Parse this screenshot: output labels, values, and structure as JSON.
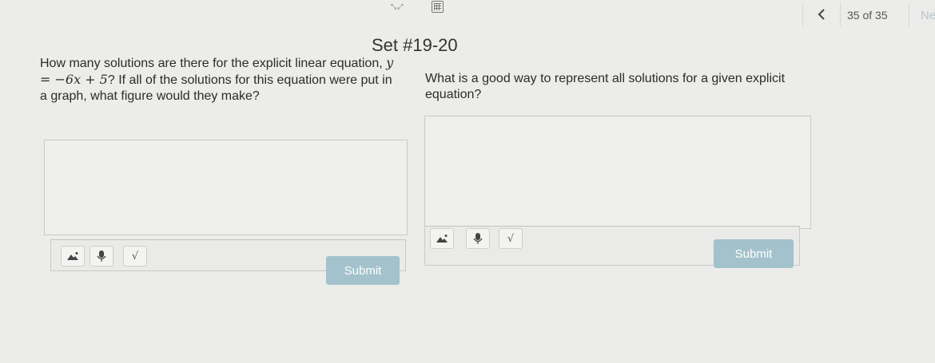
{
  "topbar": {
    "page_count": "35 of 35",
    "next_label": "Ne"
  },
  "set_title": "Set #19-20",
  "questions": [
    {
      "text_before": "How many solutions are there for the explicit linear equation, ",
      "equation": "y = −6x + 5",
      "text_after": "? If all of the solutions for this equation were put in a graph, what figure would they make?",
      "submit_label": "Submit"
    },
    {
      "text": "What is a good way to represent all solutions for a given explicit equation?",
      "submit_label": "Submit"
    }
  ],
  "toolbar": {
    "sqrt_label": "√"
  },
  "colors": {
    "submit_bg": "#a3c2cc",
    "page_bg": "#ececea"
  },
  "icons": [
    "expand-icon",
    "calculator-icon",
    "chevron-left-icon",
    "image-icon",
    "microphone-icon",
    "square-root-icon"
  ]
}
